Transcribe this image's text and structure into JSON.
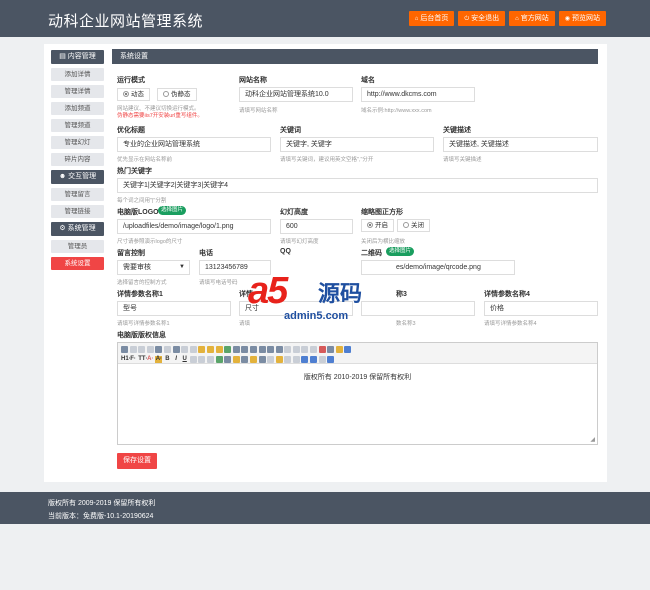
{
  "header": {
    "title": "动科企业网站管理系统",
    "buttons": [
      {
        "label": "后台首页",
        "icon": "home-icon"
      },
      {
        "label": "安全退出",
        "icon": "logout-icon"
      },
      {
        "label": "官方网站",
        "icon": "globe-icon"
      },
      {
        "label": "预览网站",
        "icon": "eye-icon"
      }
    ]
  },
  "sidebar": {
    "groups": [
      {
        "label": "内容管理",
        "icon": "list-icon",
        "items": [
          "添加详情",
          "管理详情",
          "添加频道",
          "管理频道",
          "管理幻灯",
          "碎片内容"
        ]
      },
      {
        "label": "交互管理",
        "icon": "users-icon",
        "items": [
          "管理留言",
          "管理链接"
        ]
      },
      {
        "label": "系统管理",
        "icon": "gear-icon",
        "items": [
          "管理员",
          "系统设置"
        ]
      }
    ],
    "active_item": "系统设置"
  },
  "panel": {
    "title": "系统设置"
  },
  "form": {
    "run_mode": {
      "label": "运行模式",
      "opt_dynamic": "动态",
      "opt_pseudo": "伪静态",
      "selected": "动态",
      "hint1": "网站建议、不建议切换运行模式。",
      "hint2": "伪静态需要iis7开安装url重写组件。"
    },
    "site_name": {
      "label": "网站名称",
      "value": "动科企业网站管理系统10.0",
      "hint": "请填写网站名称"
    },
    "domain": {
      "label": "域名",
      "value": "http://www.dkcms.com",
      "hint": "域名示例:http://www.xxx.com"
    },
    "seo_title": {
      "label": "优化标题",
      "value": "专业的企业网站管理系统",
      "hint": "优先显示在网站名称前"
    },
    "keywords": {
      "label": "关键词",
      "value": "关键字, 关键字",
      "hint": "请填写关键词，建议用英文空格\",\"分开"
    },
    "description": {
      "label": "关键描述",
      "value": "关键描述, 关键描述",
      "hint": "请填写关键描述"
    },
    "hot_keywords": {
      "label": "热门关键字",
      "value": "关键字1|关键字2|关键字3|关键字4",
      "hint": "每个词之间用\"|\"分割"
    },
    "pc_logo": {
      "label": "电脑版LOGO",
      "badge": "选择图片",
      "value": "/uploadfiles/demo/image/logo/1.png",
      "hint": "尺寸请参照演示logo的尺寸"
    },
    "slide_height": {
      "label": "幻灯高度",
      "value": "600",
      "hint": "请填写幻灯高度"
    },
    "thumb_square": {
      "label": "缩略图正方形",
      "opt_on": "开启",
      "opt_off": "关闭",
      "selected": "开启",
      "hint": "关闭后为横比缩放"
    },
    "guestbook": {
      "label": "留言控制",
      "value": "需要审核",
      "hint": "选择留言的控制方式"
    },
    "phone": {
      "label": "电话",
      "value": "13123456789",
      "hint": "请填写电话号码"
    },
    "qq": {
      "label": "QQ"
    },
    "qrcode": {
      "label": "二维码",
      "badge": "选择图片",
      "value": "es/demo/image/qrcode.png"
    },
    "params": [
      {
        "label": "详情参数名称1",
        "value": "型号",
        "hint": "请填写详情参数名称1"
      },
      {
        "label": "详情",
        "value": "尺寸",
        "hint": "请填"
      },
      {
        "label": "称3",
        "value": "",
        "hint": "数名称3"
      },
      {
        "label": "详情参数名称4",
        "value": "价格",
        "hint": "请填写详情参数名称4"
      }
    ],
    "copyright": {
      "label": "电脑版版权信息",
      "content": "版权所有 2010-2019 保留所有权利"
    },
    "save_label": "保存设置"
  },
  "toolbar": {
    "row2_text": [
      "H1·",
      "F·",
      "TT·",
      "A·",
      "A·",
      "B",
      "I",
      "U"
    ]
  },
  "watermark": {
    "a5": "a5",
    "yuan": "源码",
    "domain": "admin5.com"
  },
  "footer": {
    "line1": "版权所有 2009-2019 保留所有权利",
    "line2": "当前版本：免费版-10.1-20190624"
  }
}
